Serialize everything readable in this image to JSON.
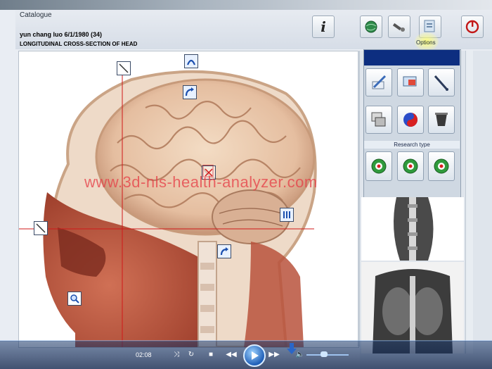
{
  "header": {
    "window_title": "Catalogue",
    "patient_line": "yun chang luo 6/1/1980 (34)",
    "section_title": "LONGITUDINAL CROSS-SECTION OF HEAD",
    "options_label": "Options",
    "buttons": [
      "info-icon",
      "globe-icon",
      "wrench-icon",
      "options-icon",
      "power-icon"
    ]
  },
  "viewer": {
    "watermark": "www.3d-nls-health-analyzer.com",
    "markers": [
      "diagonal-marker",
      "up-arrow-marker",
      "rotate-arrow-marker",
      "scan-marker",
      "lines-marker",
      "diagonal-left-marker",
      "turn-arrow-marker",
      "zoom-marker"
    ]
  },
  "tools": {
    "research_type_label": "Research type",
    "research_buttons": [
      "green-target-1",
      "green-target-2",
      "green-target-3"
    ]
  },
  "player": {
    "time": "02:08"
  },
  "colors": {
    "accent": "#0d2e80",
    "crosshair": "#d01818",
    "watermark": "#e63c46"
  }
}
